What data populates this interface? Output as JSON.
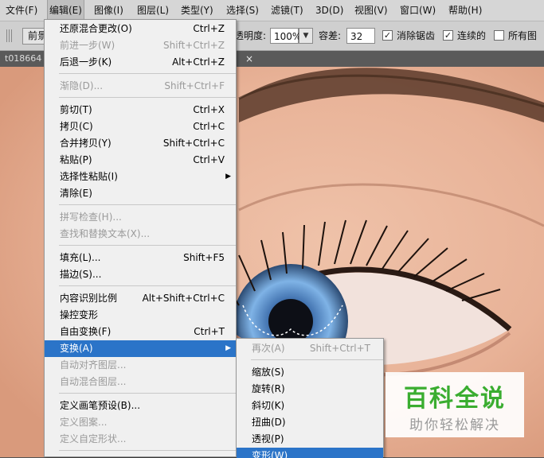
{
  "menubar": {
    "items": [
      "文件(F)",
      "编辑(E)",
      "图像(I)",
      "图层(L)",
      "类型(Y)",
      "选择(S)",
      "滤镜(T)",
      "3D(D)",
      "视图(V)",
      "窗口(W)",
      "帮助(H)"
    ],
    "active": "编辑(E)"
  },
  "options_bar": {
    "preset_label": "前景",
    "opacity_label": "透明度:",
    "opacity_value": "100%",
    "tolerance_label": "容差:",
    "tolerance_value": "32",
    "antialias_label": "消除锯齿",
    "antialias_checked": true,
    "contiguous_label": "连续的",
    "contiguous_checked": true,
    "all_layers_label": "所有图层",
    "all_layers_checked": false
  },
  "tabbar": {
    "doc_tab": "t018664",
    "close_glyph": "×"
  },
  "edit_menu": {
    "items": [
      {
        "label": "还原混合更改(O)",
        "shortcut": "Ctrl+Z",
        "state": "enabled"
      },
      {
        "label": "前进一步(W)",
        "shortcut": "Shift+Ctrl+Z",
        "state": "disabled"
      },
      {
        "label": "后退一步(K)",
        "shortcut": "Alt+Ctrl+Z",
        "state": "enabled"
      },
      {
        "label": "渐隐(D)...",
        "shortcut": "Shift+Ctrl+F",
        "state": "disabled"
      },
      {
        "label": "剪切(T)",
        "shortcut": "Ctrl+X",
        "state": "enabled"
      },
      {
        "label": "拷贝(C)",
        "shortcut": "Ctrl+C",
        "state": "enabled"
      },
      {
        "label": "合并拷贝(Y)",
        "shortcut": "Shift+Ctrl+C",
        "state": "enabled"
      },
      {
        "label": "粘贴(P)",
        "shortcut": "Ctrl+V",
        "state": "enabled"
      },
      {
        "label": "选择性粘贴(I)",
        "shortcut": "",
        "state": "enabled",
        "submenu": true
      },
      {
        "label": "清除(E)",
        "shortcut": "",
        "state": "enabled"
      },
      {
        "label": "拼写检查(H)...",
        "shortcut": "",
        "state": "disabled"
      },
      {
        "label": "查找和替换文本(X)...",
        "shortcut": "",
        "state": "disabled"
      },
      {
        "label": "填充(L)...",
        "shortcut": "Shift+F5",
        "state": "enabled"
      },
      {
        "label": "描边(S)...",
        "shortcut": "",
        "state": "enabled"
      },
      {
        "label": "内容识别比例",
        "shortcut": "Alt+Shift+Ctrl+C",
        "state": "enabled"
      },
      {
        "label": "操控变形",
        "shortcut": "",
        "state": "enabled"
      },
      {
        "label": "自由变换(F)",
        "shortcut": "Ctrl+T",
        "state": "enabled"
      },
      {
        "label": "变换(A)",
        "shortcut": "",
        "state": "highlighted",
        "submenu": true
      },
      {
        "label": "自动对齐图层...",
        "shortcut": "",
        "state": "disabled"
      },
      {
        "label": "自动混合图层...",
        "shortcut": "",
        "state": "disabled"
      },
      {
        "label": "定义画笔预设(B)...",
        "shortcut": "",
        "state": "enabled"
      },
      {
        "label": "定义图案...",
        "shortcut": "",
        "state": "disabled"
      },
      {
        "label": "定义自定形状...",
        "shortcut": "",
        "state": "disabled"
      }
    ]
  },
  "transform_submenu": {
    "items": [
      {
        "label": "再次(A)",
        "shortcut": "Shift+Ctrl+T",
        "state": "disabled"
      },
      {
        "label": "缩放(S)",
        "shortcut": "",
        "state": "enabled"
      },
      {
        "label": "旋转(R)",
        "shortcut": "",
        "state": "enabled"
      },
      {
        "label": "斜切(K)",
        "shortcut": "",
        "state": "enabled"
      },
      {
        "label": "扭曲(D)",
        "shortcut": "",
        "state": "enabled"
      },
      {
        "label": "透视(P)",
        "shortcut": "",
        "state": "enabled"
      },
      {
        "label": "变形(W)",
        "shortcut": "",
        "state": "highlighted"
      }
    ]
  },
  "watermark": {
    "title": "百科全说",
    "subtitle": "助你轻松解决"
  },
  "colors": {
    "menu_highlight": "#2b74c8",
    "watermark_green": "#3aad30"
  }
}
